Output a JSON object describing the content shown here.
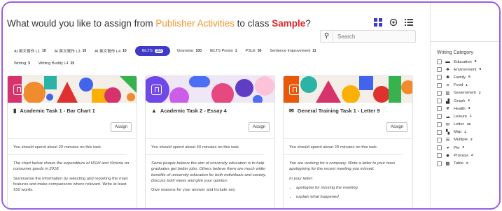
{
  "header": {
    "prefix": "What would you like to assign from ",
    "publisher": "Publisher Activities",
    "middle": " to class ",
    "class_name": "Sample",
    "suffix": "?"
  },
  "search": {
    "placeholder": "Search"
  },
  "tags_row1": [
    {
      "label": "AI 英文寫作 L1",
      "count": "10"
    },
    {
      "label": "AI 英文寫作 L3",
      "count": "10"
    },
    {
      "label": "AI 英文寫作 L4",
      "count": "10"
    },
    {
      "label": "IELTS",
      "count": "115",
      "active": true
    },
    {
      "label": "Grammar",
      "count": "100"
    },
    {
      "label": "IELTS Presto",
      "count": "1"
    },
    {
      "label": "PSLE",
      "count": "30"
    },
    {
      "label": "Sentence Improvement",
      "count": "11"
    }
  ],
  "tags_row2": [
    {
      "label": "Writing",
      "count": "5"
    },
    {
      "label": "Writing Buddy L4",
      "count": "25"
    }
  ],
  "cards": [
    {
      "title": "Academic Task 1 - Bar Chart 1",
      "icon": "bar-chart-icon",
      "assign": "Assign",
      "intro": "You should spend about 20 minutes on this task.",
      "p1": "The chart below shows the expenditure of NSW and Victoria on consumer goods in 2018.",
      "p2": "Summarise the information by selecting and reporting the main features and make comparisons where relevant. Write at least 150 words."
    },
    {
      "title": "Academic Task 2 - Essay 4",
      "icon": "graduation-cap-icon",
      "assign": "Assign",
      "intro": "You should spend about 40 minutes on this task.",
      "p1": "Some people believe the aim of university education is to help graduates get better jobs. Others believe there are much wider benefits of university education for both individuals and society. Discuss both views and give your opinion.",
      "p2": "Give reasons for your answer and include any"
    },
    {
      "title": "General Training Task 1 - Letter 9",
      "icon": "envelope-icon",
      "assign": "Assign",
      "intro": "You should spend about 20 minutes on this task.",
      "p1": "You are working for a company. Write a letter to your boss apologising for the recent meeting you missed.",
      "p2": "In your letter:",
      "bullets": [
        "apologise for missing the meeting",
        "explain what happened"
      ]
    }
  ],
  "sidebar": {
    "title": "Writing Category",
    "items": [
      {
        "icon": "graduation-cap-icon",
        "glyph": "▬",
        "label": "Education",
        "count": "8"
      },
      {
        "icon": "leaf-icon",
        "glyph": "♣",
        "label": "Environment",
        "count": "6"
      },
      {
        "icon": "family-icon",
        "glyph": "☻",
        "label": "Family",
        "count": "6"
      },
      {
        "icon": "food-icon",
        "glyph": "≡",
        "label": "Food",
        "count": "1"
      },
      {
        "icon": "government-icon",
        "glyph": "▥",
        "label": "Government",
        "count": "2"
      },
      {
        "icon": "graph-icon",
        "glyph": "▟",
        "label": "Graph",
        "count": "4"
      },
      {
        "icon": "heart-icon",
        "glyph": "♥",
        "label": "Health",
        "count": "3"
      },
      {
        "icon": "leisure-icon",
        "glyph": "☁",
        "label": "Leisure",
        "count": "1"
      },
      {
        "icon": "envelope-icon",
        "glyph": "✉",
        "label": "Letter",
        "count": "12"
      },
      {
        "icon": "map-icon",
        "glyph": "▚",
        "label": "Map",
        "count": "2"
      },
      {
        "icon": "list-icon",
        "glyph": "☰",
        "label": "Multiple",
        "count": "2"
      },
      {
        "icon": "pie-icon",
        "glyph": "◕",
        "label": "Pie",
        "count": "2"
      },
      {
        "icon": "process-icon",
        "glyph": "✸",
        "label": "Process",
        "count": "2"
      },
      {
        "icon": "table-icon",
        "glyph": "▦",
        "label": "Table",
        "count": "2"
      }
    ]
  },
  "colors": {
    "accent": "#3f3bc8",
    "publisher": "#f0962a",
    "class": "#e0262a",
    "frame": "#9b5de5"
  }
}
